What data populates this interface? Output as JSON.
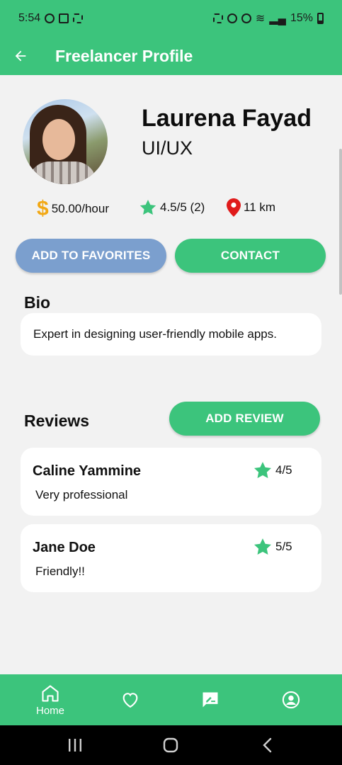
{
  "status_bar": {
    "time": "5:54",
    "battery": "15%"
  },
  "app_bar": {
    "title": "Freelancer Profile"
  },
  "profile": {
    "name": "Laurena Fayad",
    "role": "UI/UX",
    "currency_symbol": "$",
    "rate": "50.00/hour",
    "rating": "4.5/5 (2)",
    "distance": "11 km"
  },
  "actions": {
    "favorite_label": "ADD TO FAVORITES",
    "contact_label": "CONTACT",
    "add_review_label": "ADD REVIEW"
  },
  "bio": {
    "label": "Bio",
    "text": "Expert in designing user-friendly mobile apps."
  },
  "reviews": {
    "label": "Reviews",
    "items": [
      {
        "reviewer": "Caline Yammine",
        "score": "4/5",
        "text": "Very professional"
      },
      {
        "reviewer": "Jane Doe",
        "score": "5/5",
        "text": "Friendly!!"
      }
    ]
  },
  "bottom_nav": {
    "home_label": "Home",
    "items": [
      "home-icon",
      "heart-icon",
      "review-icon",
      "account-icon"
    ]
  },
  "colors": {
    "primary": "#3cc47c",
    "favorite_button": "#7b9fce",
    "dollar": "#f2a814",
    "star": "#3cc47c",
    "pin": "#e01b1b",
    "background": "#f2f2f2"
  }
}
